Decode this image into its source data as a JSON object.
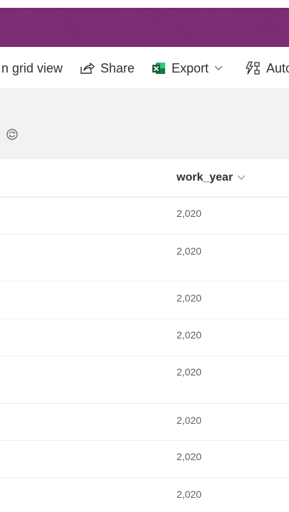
{
  "command_bar": {
    "grid_view_label": "n grid view",
    "share_label": "Share",
    "export_label": "Export",
    "automate_label": "Auto"
  },
  "table": {
    "column_header": "work_year",
    "rows": [
      "2,020",
      "2,020",
      "2,020",
      "2,020",
      "2,020",
      "2,020",
      "2,020",
      "2,020"
    ]
  },
  "colors": {
    "brand": "#7b2a73",
    "band": "#f3f2f1",
    "excel_green": "#1d6f42"
  },
  "icons": {
    "share": "share-icon",
    "export": "excel-icon",
    "automate": "flow-icon",
    "refresh": "refresh-icon",
    "dropdown": "chevron-down-icon"
  }
}
